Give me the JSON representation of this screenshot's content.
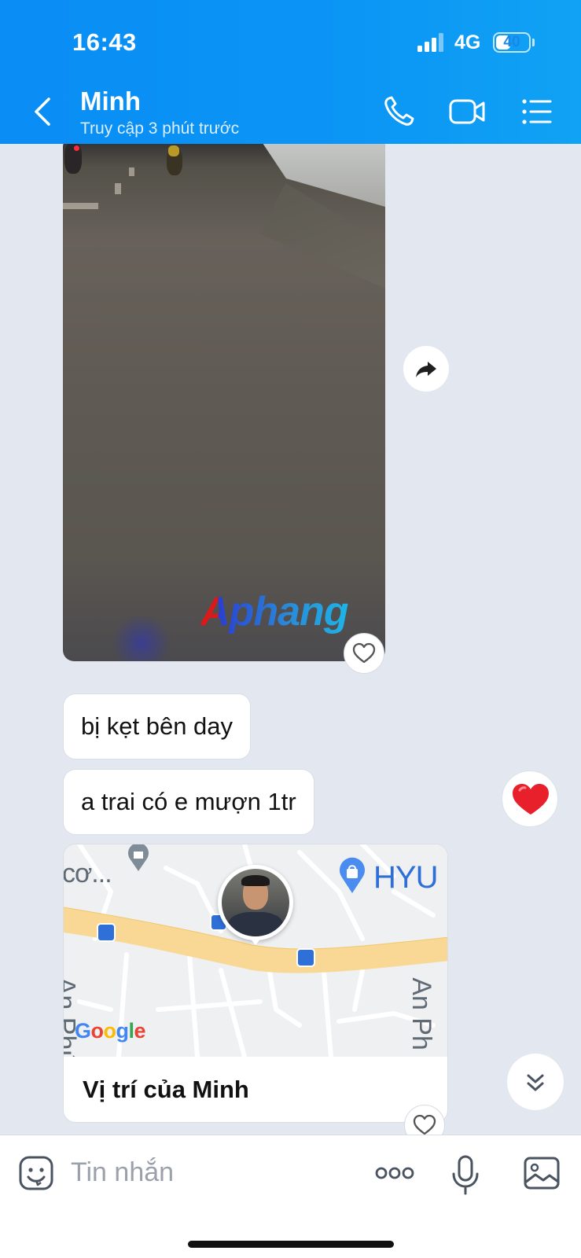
{
  "status_bar": {
    "time": "16:43",
    "network": "4G",
    "battery": "40"
  },
  "header": {
    "contact_name": "Minh",
    "last_seen": "Truy cập 3 phút trước",
    "icons": [
      "back-icon",
      "phone-icon",
      "video-call-icon",
      "menu-list-icon"
    ]
  },
  "messages": {
    "video_watermark": "Aphang",
    "bubble_1": "bị kẹt bên day",
    "bubble_2": "a trai có e mượn 1tr",
    "reaction": "heart",
    "location": {
      "caption": "Vị trí của Minh",
      "map_labels": {
        "top_left": "cơ...",
        "poi": "HYU",
        "street_left": "An Phú",
        "street_right": "An Ph",
        "provider": "Google"
      }
    }
  },
  "input_bar": {
    "placeholder": "Tin nhắn",
    "more": "ooo",
    "icons": [
      "sticker-icon",
      "more-icon",
      "microphone-icon",
      "image-icon"
    ]
  },
  "colors": {
    "header_blue": "#0b95f5",
    "chat_bg": "#e3e8f0",
    "heart_red": "#e8202c"
  }
}
